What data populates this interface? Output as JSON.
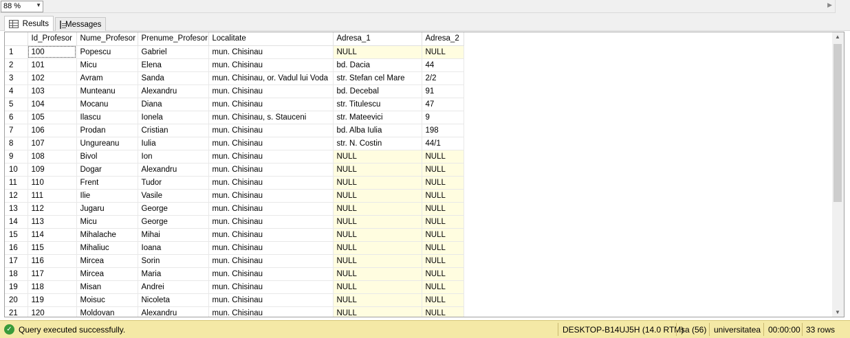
{
  "zoom": {
    "value": "88 %"
  },
  "tabs": [
    {
      "label": "Results"
    },
    {
      "label": "Messages"
    }
  ],
  "grid": {
    "columns": [
      "",
      "Id_Profesor",
      "Nume_Profesor",
      "Prenume_Profesor",
      "Localitate",
      "Adresa_1",
      "Adresa_2"
    ],
    "rows": [
      [
        "1",
        "100",
        "Popescu",
        "Gabriel",
        "mun. Chisinau",
        "NULL",
        "NULL"
      ],
      [
        "2",
        "101",
        "Micu",
        "Elena",
        "mun. Chisinau",
        " bd. Dacia",
        " 44"
      ],
      [
        "3",
        "102",
        "Avram",
        "Sanda",
        "mun. Chisinau, or. Vadul lui Voda",
        " str. Stefan cel Mare",
        " 2/2"
      ],
      [
        "4",
        "103",
        "Munteanu",
        "Alexandru",
        "mun. Chisinau",
        " bd. Decebal",
        " 91"
      ],
      [
        "5",
        "104",
        "Mocanu",
        "Diana",
        "mun. Chisinau",
        " str. Titulescu",
        " 47"
      ],
      [
        "6",
        "105",
        "Ilascu",
        "Ionela",
        "mun. Chisinau, s. Stauceni",
        " str. Mateevici",
        " 9"
      ],
      [
        "7",
        "106",
        "Prodan",
        "Cristian",
        "mun. Chisinau",
        " bd. Alba Iulia",
        " 198"
      ],
      [
        "8",
        "107",
        "Ungureanu",
        "Iulia",
        "mun. Chisinau",
        " str. N. Costin",
        " 44/1"
      ],
      [
        "9",
        "108",
        "Bivol",
        "Ion",
        "mun. Chisinau",
        "NULL",
        "NULL"
      ],
      [
        "10",
        "109",
        "Dogar",
        "Alexandru",
        "mun. Chisinau",
        "NULL",
        "NULL"
      ],
      [
        "11",
        "110",
        "Frent",
        "Tudor",
        "mun. Chisinau",
        "NULL",
        "NULL"
      ],
      [
        "12",
        "111",
        "Ilie",
        "Vasile",
        "mun. Chisinau",
        "NULL",
        "NULL"
      ],
      [
        "13",
        "112",
        "Jugaru",
        "George",
        "mun. Chisinau",
        "NULL",
        "NULL"
      ],
      [
        "14",
        "113",
        "Micu",
        "George",
        "mun. Chisinau",
        "NULL",
        "NULL"
      ],
      [
        "15",
        "114",
        "Mihalache",
        "Mihai",
        "mun. Chisinau",
        "NULL",
        "NULL"
      ],
      [
        "16",
        "115",
        "Mihaliuc",
        "Ioana",
        "mun. Chisinau",
        "NULL",
        "NULL"
      ],
      [
        "17",
        "116",
        "Mircea",
        "Sorin",
        "mun. Chisinau",
        "NULL",
        "NULL"
      ],
      [
        "18",
        "117",
        "Mircea",
        "Maria",
        "mun. Chisinau",
        "NULL",
        "NULL"
      ],
      [
        "19",
        "118",
        "Misan",
        "Andrei",
        "mun. Chisinau",
        "NULL",
        "NULL"
      ],
      [
        "20",
        "119",
        "Moisuc",
        "Nicoleta",
        "mun. Chisinau",
        "NULL",
        "NULL"
      ],
      [
        "21",
        "120",
        "Moldovan",
        "Alexandru",
        "mun. Chisinau",
        "NULL",
        "NULL"
      ]
    ]
  },
  "status": {
    "message": "Query executed successfully.",
    "server": "DESKTOP-B14UJ5H (14.0 RTM)",
    "user": "sa (56)",
    "database": "universitatea",
    "elapsed": "00:00:00",
    "rows": "33 rows",
    "icon": "check-circle-icon",
    "bar_color": "#f4e9a6"
  },
  "colors": {
    "null_cell": "#fffde0",
    "status_ok": "#3a9b3a"
  }
}
